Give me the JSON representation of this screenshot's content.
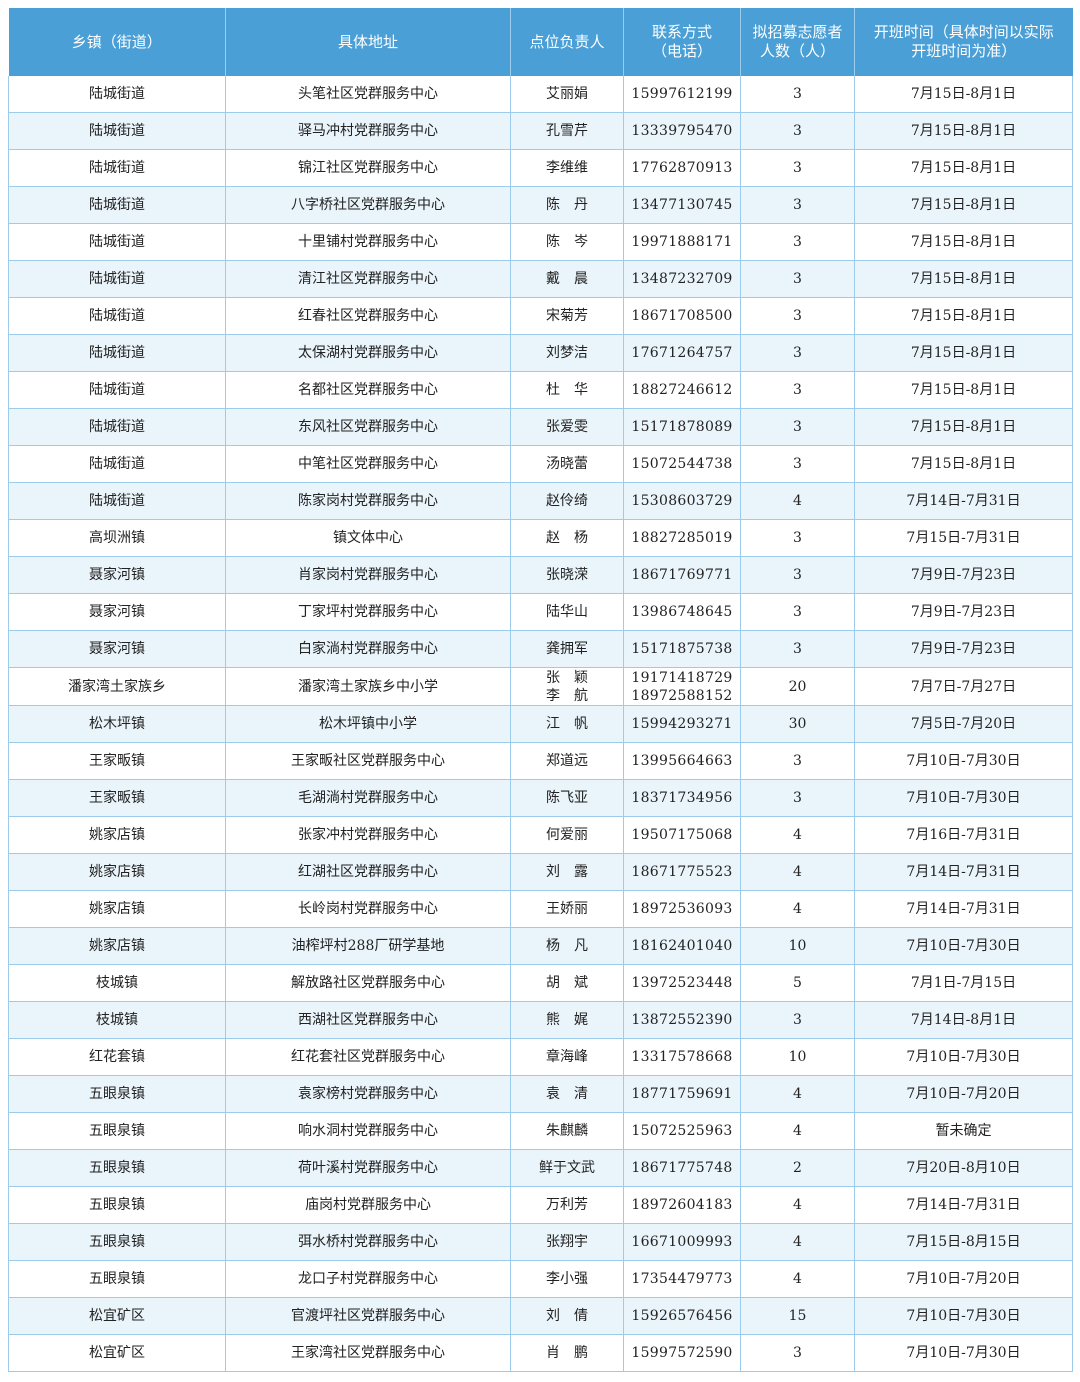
{
  "table": {
    "headers": [
      "乡镇（街道）",
      "具体地址",
      "点位负责人",
      "联系方式\n（电话）",
      "拟招募志愿者\n人数（人）",
      "开班时间（具体时间以实际\n开班时间为准）"
    ],
    "rows": [
      [
        "陆城街道",
        "头笔社区党群服务中心",
        "艾丽娟",
        "15997612199",
        "3",
        "7月15日-8月1日"
      ],
      [
        "陆城街道",
        "驿马冲村党群服务中心",
        "孔雪芹",
        "13339795470",
        "3",
        "7月15日-8月1日"
      ],
      [
        "陆城街道",
        "锦江社区党群服务中心",
        "李维维",
        "17762870913",
        "3",
        "7月15日-8月1日"
      ],
      [
        "陆城街道",
        "八字桥社区党群服务中心",
        "陈　丹",
        "13477130745",
        "3",
        "7月15日-8月1日"
      ],
      [
        "陆城街道",
        "十里铺村党群服务中心",
        "陈　岑",
        "19971888171",
        "3",
        "7月15日-8月1日"
      ],
      [
        "陆城街道",
        "清江社区党群服务中心",
        "戴　晨",
        "13487232709",
        "3",
        "7月15日-8月1日"
      ],
      [
        "陆城街道",
        "红春社区党群服务中心",
        "宋菊芳",
        "18671708500",
        "3",
        "7月15日-8月1日"
      ],
      [
        "陆城街道",
        "太保湖村党群服务中心",
        "刘梦洁",
        "17671264757",
        "3",
        "7月15日-8月1日"
      ],
      [
        "陆城街道",
        "名都社区党群服务中心",
        "杜　华",
        "18827246612",
        "3",
        "7月15日-8月1日"
      ],
      [
        "陆城街道",
        "东风社区党群服务中心",
        "张爱雯",
        "15171878089",
        "3",
        "7月15日-8月1日"
      ],
      [
        "陆城街道",
        "中笔社区党群服务中心",
        "汤晓蕾",
        "15072544738",
        "3",
        "7月15日-8月1日"
      ],
      [
        "陆城街道",
        "陈家岗村党群服务中心",
        "赵伶绮",
        "15308603729",
        "4",
        "7月14日-7月31日"
      ],
      [
        "高坝洲镇",
        "镇文体中心",
        "赵　杨",
        "18827285019",
        "3",
        "7月15日-7月31日"
      ],
      [
        "聂家河镇",
        "肖家岗村党群服务中心",
        "张晓溁",
        "18671769771",
        "3",
        "7月9日-7月23日"
      ],
      [
        "聂家河镇",
        "丁家坪村党群服务中心",
        "陆华山",
        "13986748645",
        "3",
        "7月9日-7月23日"
      ],
      [
        "聂家河镇",
        "白家淌村党群服务中心",
        "龚拥军",
        "15171875738",
        "3",
        "7月9日-7月23日"
      ],
      [
        "潘家湾土家族乡",
        "潘家湾土家族乡中小学",
        "张　颖\n李　航",
        "19171418729\n18972588152",
        "20",
        "7月7日-7月27日"
      ],
      [
        "松木坪镇",
        "松木坪镇中小学",
        "江　帆",
        "15994293271",
        "30",
        "7月5日-7月20日"
      ],
      [
        "王家畈镇",
        "王家畈社区党群服务中心",
        "郑道远",
        "13995664663",
        "3",
        "7月10日-7月30日"
      ],
      [
        "王家畈镇",
        "毛湖淌村党群服务中心",
        "陈飞亚",
        "18371734956",
        "3",
        "7月10日-7月30日"
      ],
      [
        "姚家店镇",
        "张家冲村党群服务中心",
        "何爱丽",
        "19507175068",
        "4",
        "7月16日-7月31日"
      ],
      [
        "姚家店镇",
        "红湖社区党群服务中心",
        "刘　露",
        "18671775523",
        "4",
        "7月14日-7月31日"
      ],
      [
        "姚家店镇",
        "长岭岗村党群服务中心",
        "王娇丽",
        "18972536093",
        "4",
        "7月14日-7月31日"
      ],
      [
        "姚家店镇",
        "油榨坪村288厂研学基地",
        "杨　凡",
        "18162401040",
        "10",
        "7月10日-7月30日"
      ],
      [
        "枝城镇",
        "解放路社区党群服务中心",
        "胡　斌",
        "13972523448",
        "5",
        "7月1日-7月15日"
      ],
      [
        "枝城镇",
        "西湖社区党群服务中心",
        "熊　娓",
        "13872552390",
        "3",
        "7月14日-8月1日"
      ],
      [
        "红花套镇",
        "红花套社区党群服务中心",
        "章海峰",
        "13317578668",
        "10",
        "7月10日-7月30日"
      ],
      [
        "五眼泉镇",
        "袁家榜村党群服务中心",
        "袁　清",
        "18771759691",
        "4",
        "7月10日-7月20日"
      ],
      [
        "五眼泉镇",
        "响水洞村党群服务中心",
        "朱麒麟",
        "15072525963",
        "4",
        "暂未确定"
      ],
      [
        "五眼泉镇",
        "荷叶溪村党群服务中心",
        "鲜于文武",
        "18671775748",
        "2",
        "7月20日-8月10日"
      ],
      [
        "五眼泉镇",
        "庙岗村党群服务中心",
        "万利芳",
        "18972604183",
        "4",
        "7月14日-7月31日"
      ],
      [
        "五眼泉镇",
        "弭水桥村党群服务中心",
        "张翔宇",
        "16671009993",
        "4",
        "7月15日-8月15日"
      ],
      [
        "五眼泉镇",
        "龙口子村党群服务中心",
        "李小强",
        "17354479773",
        "4",
        "7月10日-7月20日"
      ],
      [
        "松宜矿区",
        "官渡坪社区党群服务中心",
        "刘　倩",
        "15926576456",
        "15",
        "7月10日-7月30日"
      ],
      [
        "松宜矿区",
        "王家湾社区党群服务中心",
        "肖　鹏",
        "15997572590",
        "3",
        "7月10日-7月30日"
      ]
    ]
  },
  "colors": {
    "header_bg": "#4a9fd7",
    "header_text": "#ffffff",
    "stripe_bg": "#eaf4fb",
    "border": "#9ccbec"
  }
}
